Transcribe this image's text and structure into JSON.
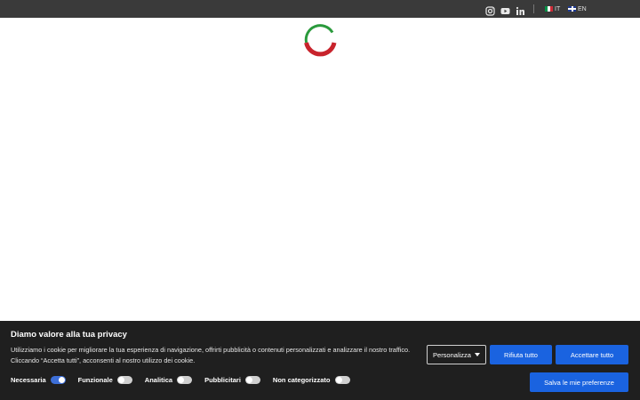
{
  "topbar": {
    "social": [
      {
        "name": "instagram-icon"
      },
      {
        "name": "youtube-icon"
      },
      {
        "name": "linkedin-icon"
      }
    ],
    "languages": [
      {
        "code": "IT",
        "flag": "italy-flag-icon"
      },
      {
        "code": "EN",
        "flag": "uk-flag-icon"
      }
    ]
  },
  "loader": {
    "colors": {
      "green": "#2a9a3c",
      "red": "#c8232c"
    }
  },
  "cookie_banner": {
    "title": "Diamo valore alla tua privacy",
    "text": "Utilizziamo i cookie per migliorare la tua esperienza di navigazione, offrirti pubblicità o contenuti personalizzati e analizzare il nostro traffico. Cliccando “Accetta tutti”, acconsenti al nostro utilizzo dei cookie.",
    "customize_label": "Personalizza",
    "reject_label": "Rifiuta tutto",
    "accept_label": "Accettare tutto",
    "save_label": "Salva le mie preferenze",
    "categories": [
      {
        "label": "Necessaria",
        "enabled": true
      },
      {
        "label": "Funzionale",
        "enabled": false
      },
      {
        "label": "Analitica",
        "enabled": false
      },
      {
        "label": "Pubblicitari",
        "enabled": false
      },
      {
        "label": "Non categorizzato",
        "enabled": false
      }
    ],
    "colors": {
      "background": "#1f1f1f",
      "button": "#1a63e0"
    }
  }
}
